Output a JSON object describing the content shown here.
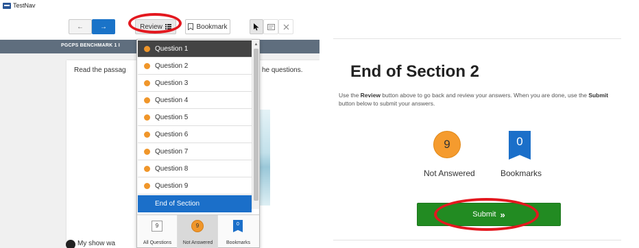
{
  "app": {
    "title": "TestNav"
  },
  "toolbar": {
    "back_icon": "←",
    "next_icon": "→",
    "review_label": "Review",
    "review_icon": "list-icon",
    "bookmark_label": "Bookmark",
    "pointer_icon": "cursor-icon",
    "tool2_icon": "answer-eliminator-icon",
    "tool3_icon": "close-icon"
  },
  "header": {
    "test_name": "PGCPS BENCHMARK 1 I"
  },
  "passage": {
    "intro_start": "Read the passag",
    "intro_end": "he questions.",
    "question_number": "1",
    "question_text": "My show wa"
  },
  "review_dropdown": {
    "items": [
      {
        "label": "Question 1",
        "status": "not-answered",
        "selected": true
      },
      {
        "label": "Question 2",
        "status": "not-answered"
      },
      {
        "label": "Question 3",
        "status": "not-answered"
      },
      {
        "label": "Question 4",
        "status": "not-answered"
      },
      {
        "label": "Question 5",
        "status": "not-answered"
      },
      {
        "label": "Question 6",
        "status": "not-answered"
      },
      {
        "label": "Question 7",
        "status": "not-answered"
      },
      {
        "label": "Question 8",
        "status": "not-answered"
      },
      {
        "label": "Question 9",
        "status": "not-answered"
      }
    ],
    "end_label": "End of Section",
    "filters": [
      {
        "label": "All Questions",
        "count": "9"
      },
      {
        "label": "Not Answered",
        "count": "9",
        "active": true
      },
      {
        "label": "Bookmarks",
        "count": "0"
      }
    ]
  },
  "section_end": {
    "title": "End of Section 2",
    "instructions_1": "Use the ",
    "instructions_review": "Review",
    "instructions_2": " button above to go back and review your answers. When you are done, use the ",
    "instructions_submit": "Submit",
    "instructions_3": " button below to submit your answers.",
    "not_answered_count": "9",
    "not_answered_label": "Not Answered",
    "bookmarks_count": "0",
    "bookmarks_label": "Bookmarks",
    "submit_label": "Submit",
    "submit_arrows": "»"
  },
  "colors": {
    "accent_blue": "#1b6fc9",
    "not_answered_orange": "#f59b2e",
    "submit_green": "#228b22",
    "highlight_red": "#e3181f",
    "header_gray": "#5f6e7e"
  }
}
